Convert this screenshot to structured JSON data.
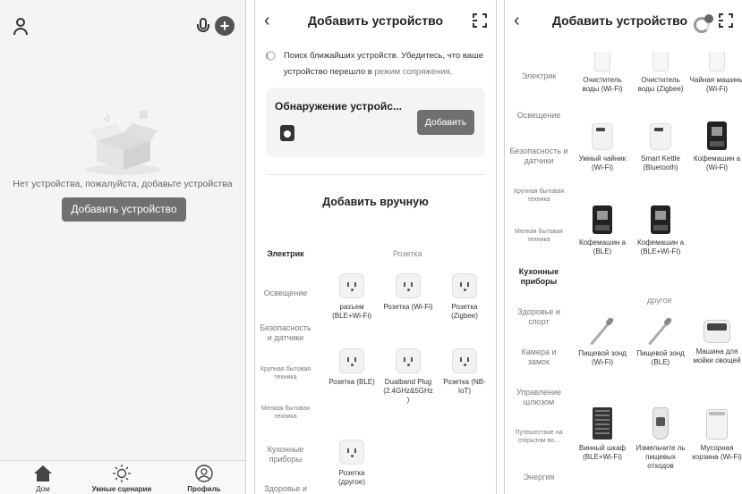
{
  "home": {
    "empty_text": "Нет устройства, пожалуйста, добавьте устройства",
    "add_device_label": "Добавить устройство",
    "tabs": [
      {
        "label": "Дом"
      },
      {
        "label": "Умные сценарии"
      },
      {
        "label": "Профиль"
      }
    ]
  },
  "add_screen": {
    "title": "Добавить устройство",
    "search_text": "Поиск ближайших устройств. Убедитесь, что ваше устройство перешло в",
    "search_link": "режим сопряжения",
    "search_end": ".",
    "found_title": "Обнаружение устройс...",
    "found_button": "Добавить",
    "manual_title": "Добавить вручную",
    "categories": [
      "Электрик",
      "Освещение",
      "Безопасность и датчики",
      "Крупная бытовая техника",
      "Мелкая бытовая техника",
      "Кухонные приборы",
      "Здоровье и"
    ],
    "section": "Розетка",
    "devices": [
      {
        "label": "разъем (BLE+Wi-Fi)",
        "icon": "socket-icon"
      },
      {
        "label": "Розетка (Wi-Fi)",
        "icon": "socket-icon"
      },
      {
        "label": "Розетка (Zigbee)",
        "icon": "socket-icon"
      },
      {
        "label": "Розетка (BLE)",
        "icon": "socket-icon"
      },
      {
        "label": "Dualband Plug (2.4GHz&5GHz )",
        "icon": "socket-icon"
      },
      {
        "label": "Розетка (NB-IoT)",
        "icon": "socket-icon"
      },
      {
        "label": "Розетка (другое)",
        "icon": "socket-icon"
      }
    ]
  },
  "kitchen_screen": {
    "title": "Добавить устройство",
    "categories": [
      "Электрик",
      "Освещение",
      "Безопасность и датчики",
      "Крупная бытовая техника",
      "Мелкая бытовая техника",
      "Кухонные приборы",
      "Здоровье и спорт",
      "Камера и замок",
      "Управление шлюзом",
      "Путешествие на открытом во...",
      "Энергия"
    ],
    "section_other": "другое",
    "devices": [
      {
        "label": "Очиститель воды (Wi-Fi)",
        "icon": "purifier-icon"
      },
      {
        "label": "Очиститель воды (Zigbee)",
        "icon": "purifier-icon"
      },
      {
        "label": "Чайная машины (Wi-Fi)",
        "icon": "purifier-icon"
      },
      {
        "label": "Умный чайник (Wi-Fi)",
        "icon": "kettle-icon"
      },
      {
        "label": "Smart Kettle (Bluetooth)",
        "icon": "kettle-icon"
      },
      {
        "label": "Кофемашин а (Wi-Fi)",
        "icon": "coffee-machine-icon"
      },
      {
        "label": "Кофемашин а (BLE)",
        "icon": "coffee-machine-icon"
      },
      {
        "label": "Кофемашин а (BLE+WI-FI)",
        "icon": "coffee-machine-icon"
      },
      {
        "label": "Пищевой зонд (Wi-Fi)",
        "icon": "food-probe-icon"
      },
      {
        "label": "Пищевой зонд (BLE)",
        "icon": "food-probe-icon"
      },
      {
        "label": "Машина для мойки овощей",
        "icon": "vegetable-washer-icon"
      },
      {
        "label": "Винный шкаф (BLE+Wi-Fi)",
        "icon": "wine-cabinet-icon"
      },
      {
        "label": "Измельчите ль пищевых отходов",
        "icon": "food-disposer-icon"
      },
      {
        "label": "Мусорная корзина (Wi-Fi)",
        "icon": "trash-bin-icon"
      }
    ]
  }
}
